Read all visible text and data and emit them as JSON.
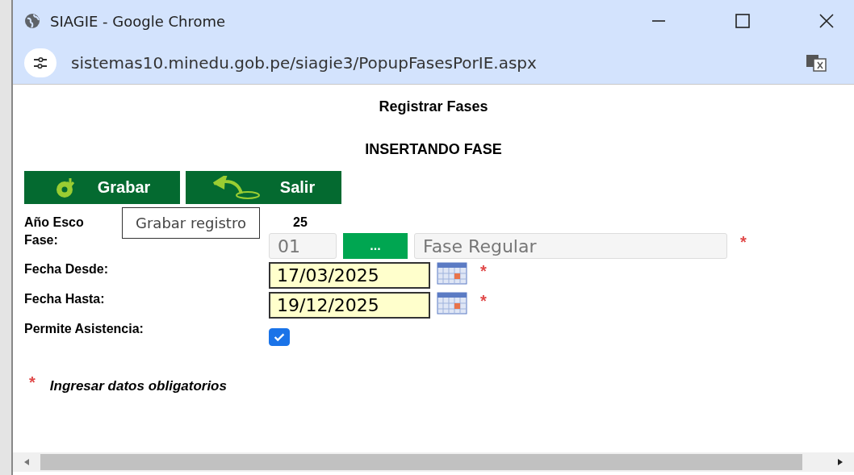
{
  "window": {
    "title": "SIAGIE - Google Chrome",
    "url": "sistemas10.minedu.gob.pe/siagie3/PopupFasesPorIE.aspx"
  },
  "page": {
    "title": "Registrar Fases",
    "subtitle": "INSERTANDO FASE"
  },
  "buttons": [
    {
      "label": "Grabar",
      "kind": "save"
    },
    {
      "label": "Salir",
      "kind": "exit"
    }
  ],
  "tooltip": "Grabar registro",
  "form": [
    {
      "kind": "text",
      "label": "Año Esco",
      "value": "25",
      "required": false
    },
    {
      "kind": "lookup",
      "label": "Fase:",
      "code": "01",
      "button": "...",
      "value": "Fase Regular",
      "required": true
    },
    {
      "kind": "date",
      "label": "Fecha Desde:",
      "value": "17/03/2025",
      "required": true
    },
    {
      "kind": "date",
      "label": "Fecha Hasta:",
      "value": "19/12/2025",
      "required": true
    },
    {
      "kind": "check",
      "label": "Permite Asistencia:",
      "checked": true,
      "required": false
    }
  ],
  "note": {
    "mark": "*",
    "text": "Ingresar datos obligatorios"
  }
}
